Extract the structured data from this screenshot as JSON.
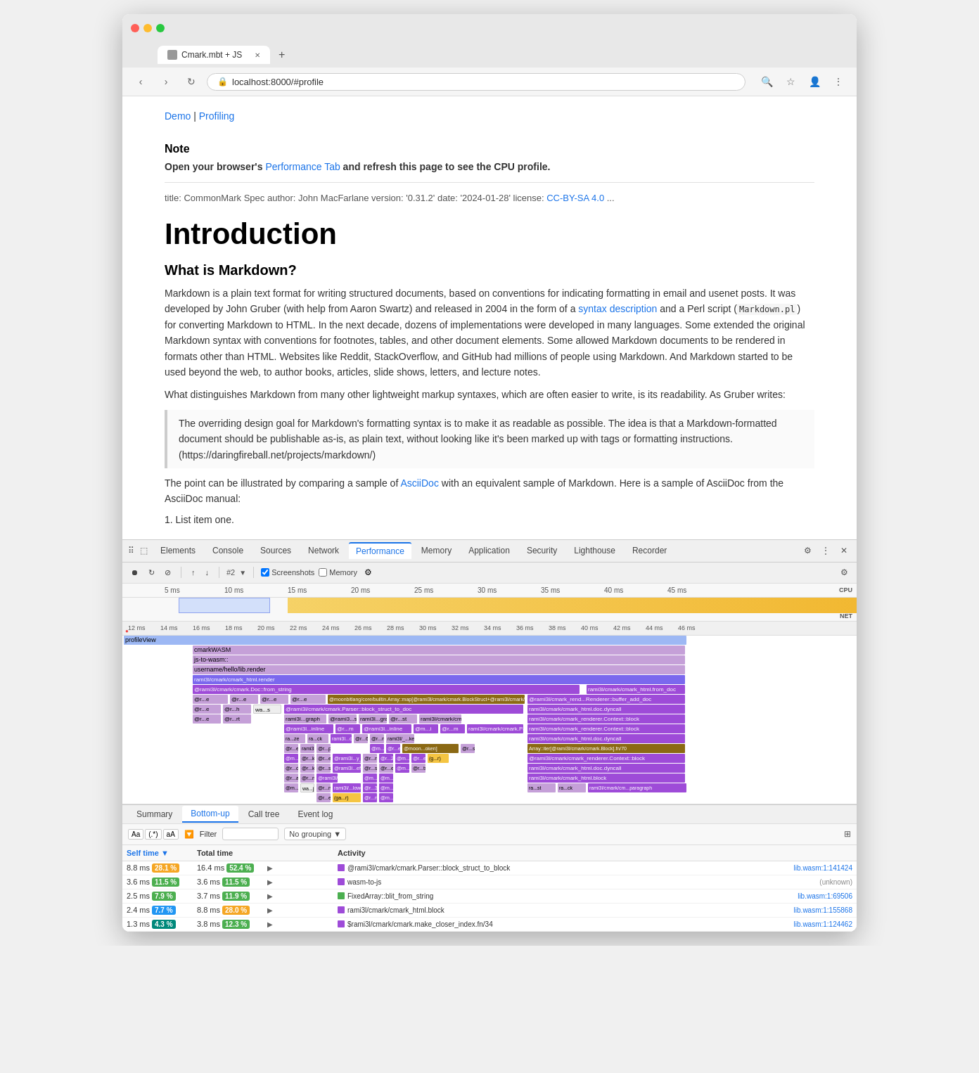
{
  "browser": {
    "tab_title": "Cmark.mbt + JS",
    "url": "localhost:8000/#profile",
    "new_tab_label": "+"
  },
  "breadcrumb": {
    "demo": "Demo",
    "sep": "|",
    "profiling": "Profiling"
  },
  "note": {
    "heading": "Note",
    "text_before": "Open your browser's ",
    "link_text": "Performance Tab",
    "text_after": " and refresh this page to see the CPU profile.",
    "meta": "title: CommonMark Spec author: John MacFarlane version: '0.31.2' date: '2024-01-28' license: ",
    "meta_link": "CC-BY-SA 4.0",
    "meta_end": " ..."
  },
  "page": {
    "main_heading": "Introduction",
    "sub_heading": "What is Markdown?",
    "body1": "Markdown is a plain text format for writing structured documents, based on conventions for indicating formatting in email and usenet posts. It was developed by John Gruber (with help from Aaron Swartz) and released in 2004 in the form of a ",
    "body1_link": "syntax description",
    "body1_mid": " and a Perl script (",
    "body1_code": "Markdown.pl",
    "body1_end": ") for converting Markdown to HTML. In the next decade, dozens of implementations were developed in many languages. Some extended the original Markdown syntax with conventions for footnotes, tables, and other document elements. Some allowed Markdown documents to be rendered in formats other than HTML. Websites like Reddit, StackOverflow, and GitHub had millions of people using Markdown. And Markdown started to be used beyond the web, to author books, articles, slide shows, letters, and lecture notes.",
    "body2": "What distinguishes Markdown from many other lightweight markup syntaxes, which are often easier to write, is its readability. As Gruber writes:",
    "blockquote": "The overriding design goal for Markdown's formatting syntax is to make it as readable as possible. The idea is that a Markdown-formatted document should be publishable as-is, as plain text, without looking like it's been marked up with tags or formatting instructions. (https://daringfireball.net/projects/markdown/)",
    "blockquote_link": "https://daringfireball.net/projects/markdown/",
    "body3_before": "The point can be illustrated by comparing a sample of ",
    "body3_link": "AsciiDoc",
    "body3_after": " with an equivalent sample of Markdown. Here is a sample of AsciiDoc from the AsciiDoc manual:",
    "list_item": "1. List item one."
  },
  "devtools": {
    "tabs": [
      "Elements",
      "Console",
      "Sources",
      "Network",
      "Performance",
      "Memory",
      "Application",
      "Security",
      "Lighthouse",
      "Recorder"
    ],
    "active_tab": "Performance",
    "perf_toolbar": {
      "record_label": "⏺",
      "refresh_label": "↻",
      "stop_label": "⊘",
      "upload_label": "↑",
      "download_label": "↓",
      "frame_label": "#2",
      "screenshots_label": "Screenshots",
      "memory_label": "Memory"
    },
    "cpu_label": "CPU",
    "net_label": "NET",
    "timeline_ticks": [
      "5 ms",
      "10 ms",
      "15 ms",
      "20 ms",
      "25 ms",
      "30 ms",
      "35 ms",
      "40 ms",
      "45 ms"
    ],
    "profile_ticks": [
      "12 ms",
      "14 ms",
      "16 ms",
      "18 ms",
      "20 ms",
      "22 ms",
      "24 ms",
      "26 ms",
      "28 ms",
      "30 ms",
      "32 ms",
      "34 ms",
      "36 ms",
      "38 ms",
      "40 ms",
      "42 ms",
      "44 ms",
      "46 ms"
    ],
    "bottom_tabs": [
      "Summary",
      "Bottom-up",
      "Call tree",
      "Event log"
    ],
    "active_bottom_tab": "Bottom-up",
    "filter": {
      "filter_label": "Filter",
      "grouping_label": "No grouping",
      "grouping_arrow": "▼"
    },
    "table": {
      "headers": [
        "Self time",
        "Total time",
        "",
        "Activity",
        ""
      ],
      "rows": [
        {
          "self_time": "8.8 ms",
          "self_pct": "28.1 %",
          "self_badge_color": "orange",
          "total_time": "16.4 ms",
          "total_pct": "52.4 %",
          "total_badge_color": "green",
          "has_expand": true,
          "color": "#9e4bd8",
          "activity": "@rami3l/cmark/cmark.Parser::block_struct_to_block",
          "link": "lib.wasm:1:141424"
        },
        {
          "self_time": "3.6 ms",
          "self_pct": "11.5 %",
          "self_badge_color": "green",
          "total_time": "3.6 ms",
          "total_pct": "11.5 %",
          "total_badge_color": "green",
          "has_expand": true,
          "color": "#9e4bd8",
          "activity": "wasm-to-js",
          "link": "(unknown)"
        },
        {
          "self_time": "2.5 ms",
          "self_pct": "7.9 %",
          "self_badge_color": "green",
          "total_time": "3.7 ms",
          "total_pct": "11.9 %",
          "total_badge_color": "green",
          "has_expand": true,
          "color": "#4caf50",
          "activity": "FixedArray::blit_from_string",
          "link": "lib.wasm:1:69506"
        },
        {
          "self_time": "2.4 ms",
          "self_pct": "7.7 %",
          "self_badge_color": "blue",
          "total_time": "8.8 ms",
          "total_pct": "28.0 %",
          "total_badge_color": "orange",
          "has_expand": true,
          "color": "#9e4bd8",
          "activity": "rami3l/cmark/cmark_html.block",
          "link": "lib.wasm:1:155868"
        },
        {
          "self_time": "1.3 ms",
          "self_pct": "4.3 %",
          "self_badge_color": "teal",
          "total_time": "3.8 ms",
          "total_pct": "12.3 %",
          "total_badge_color": "green",
          "has_expand": true,
          "color": "#9e4bd8",
          "activity": "$rami3l/cmark/cmark.make_closer_index.fn/34",
          "link": "lib.wasm:1:124462"
        }
      ]
    }
  }
}
